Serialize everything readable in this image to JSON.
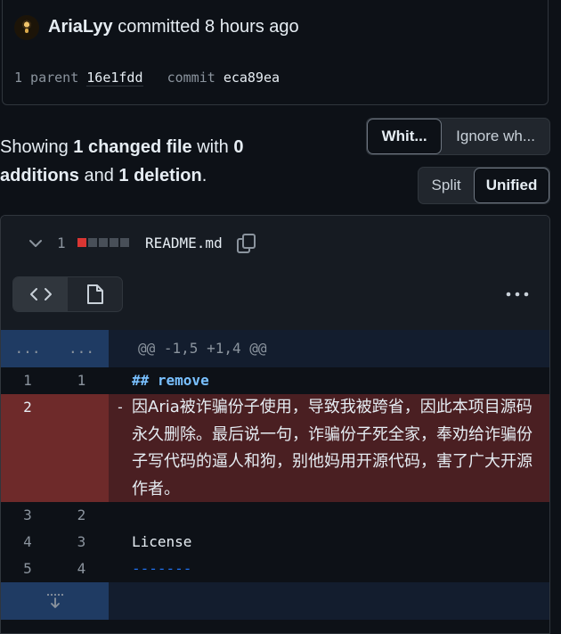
{
  "commit": {
    "author": "AriaLyy",
    "action": "committed",
    "time": "8 hours ago",
    "parent_label": "1 parent",
    "parent_sha": "16e1fdd",
    "commit_label": "commit",
    "commit_sha": "eca89ea"
  },
  "summary": {
    "showing": "Showing",
    "files": "1 changed file",
    "with": "with",
    "additions": "0 additions",
    "and": "and",
    "deletions": "1 deletion",
    "period": "."
  },
  "whitespace_toggle": {
    "options": [
      "Whit...",
      "Ignore wh..."
    ],
    "selected": "Whit..."
  },
  "view_toggle": {
    "options": [
      "Split",
      "Unified"
    ],
    "selected": "Unified"
  },
  "file": {
    "change_count": "1",
    "diffstat": [
      "deletion",
      "neutral",
      "neutral",
      "neutral",
      "neutral"
    ],
    "name": "README.md",
    "hunk_header": "@@ -1,5 +1,4 @@",
    "hunk_ellipsis": "...",
    "lines": [
      {
        "old": "1",
        "new": "1",
        "sign": "",
        "text": "## remove",
        "type": "context"
      },
      {
        "old": "2",
        "new": "",
        "sign": "-",
        "text": "因Aria被诈骗份子使用，导致我被跨省，因此本项目源码永久删除。最后说一句，诈骗份子死全家，奉劝给诈骗份子写代码的逼人和狗，别他妈用开源代码，害了广大开源作者。",
        "type": "deletion"
      },
      {
        "old": "3",
        "new": "2",
        "sign": "",
        "text": "",
        "type": "context"
      },
      {
        "old": "4",
        "new": "3",
        "sign": "",
        "text": "License",
        "type": "context"
      },
      {
        "old": "5",
        "new": "4",
        "sign": "",
        "text": "-------",
        "type": "context"
      }
    ]
  },
  "colors": {
    "background": "#0d1117",
    "deletion_bg": "#4a1f22",
    "deletion_num_bg": "#6e2a2a",
    "hunk_bg": "#1f3b63",
    "accent_blue": "#79c0ff"
  }
}
